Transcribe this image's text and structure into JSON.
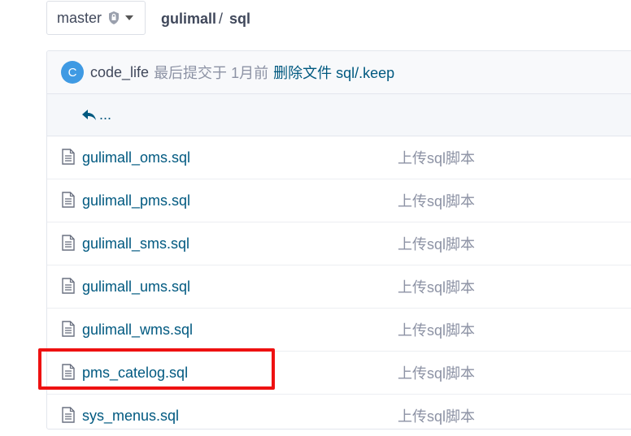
{
  "branch": {
    "name": "master",
    "lock_icon": "lock-icon",
    "caret_icon": "chevron-down-icon"
  },
  "breadcrumb": {
    "repo": "gulimall",
    "separator": "/",
    "folder": "sql"
  },
  "commit": {
    "avatar_letter": "C",
    "avatar_color": "#3f9ae3",
    "author": "code_life",
    "meta": "最后提交于 1月前",
    "message": "删除文件 sql/.keep"
  },
  "back": {
    "icon": "reply-arrow-icon",
    "label": "..."
  },
  "files": [
    {
      "name": "gulimall_oms.sql",
      "commit": "上传sql脚本"
    },
    {
      "name": "gulimall_pms.sql",
      "commit": "上传sql脚本"
    },
    {
      "name": "gulimall_sms.sql",
      "commit": "上传sql脚本"
    },
    {
      "name": "gulimall_ums.sql",
      "commit": "上传sql脚本"
    },
    {
      "name": "gulimall_wms.sql",
      "commit": "上传sql脚本"
    },
    {
      "name": "pms_catelog.sql",
      "commit": "上传sql脚本"
    },
    {
      "name": "sys_menus.sql",
      "commit": "上传sql脚本"
    }
  ],
  "colors": {
    "link": "#005980",
    "muted": "#8c92a4",
    "highlight": "#ee1111"
  }
}
